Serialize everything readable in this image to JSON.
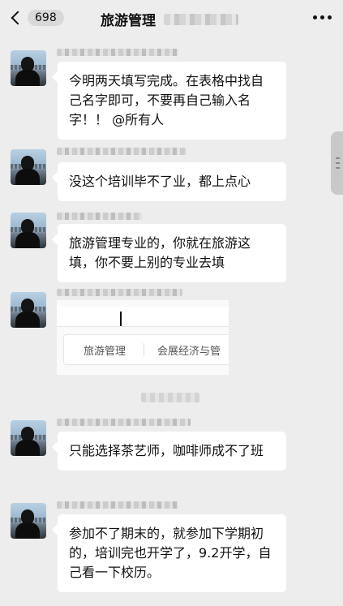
{
  "header": {
    "back_count": "698",
    "title": "旅游管理"
  },
  "messages": [
    {
      "text": "今明两天填写完成。在表格中找自己名字即可，不要再自己输入名字！！ @所有人"
    },
    {
      "text": "没这个培训毕不了业，都上点心"
    },
    {
      "text": "旅游管理专业的，你就在旅游这填，你不要上别的专业去填"
    },
    {
      "image": {
        "option1": "旅游管理",
        "option2": "会展经济与管"
      }
    },
    {
      "text": "只能选择茶艺师，咖啡师成不了班"
    },
    {
      "text": "参加不了期末的，就参加下学期初的，培训完也开学了，9.2开学，自己看一下校历。"
    }
  ],
  "icons": {
    "back": "chevron-left-icon",
    "more": "more-dots-icon"
  }
}
